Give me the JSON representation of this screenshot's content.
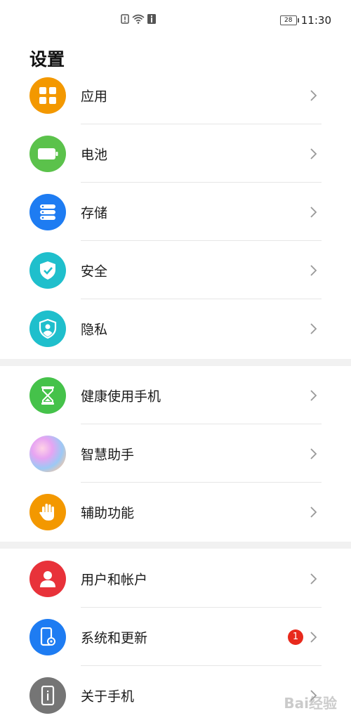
{
  "status": {
    "time": "11:30",
    "battery": "28"
  },
  "page": {
    "title": "设置"
  },
  "sections": [
    [
      {
        "label": "应用",
        "icon": "apps-icon",
        "color": "#f39800"
      },
      {
        "label": "电池",
        "icon": "battery-icon",
        "color": "#5bc24b"
      },
      {
        "label": "存储",
        "icon": "storage-icon",
        "color": "#1e7cf2"
      },
      {
        "label": "安全",
        "icon": "shield-check-icon",
        "color": "#1fbfcc"
      },
      {
        "label": "隐私",
        "icon": "privacy-icon",
        "color": "#1fbfcc"
      }
    ],
    [
      {
        "label": "健康使用手机",
        "icon": "hourglass-icon",
        "color": "#45c24a"
      },
      {
        "label": "智慧助手",
        "icon": "assistant-icon",
        "color": "gradient"
      },
      {
        "label": "辅助功能",
        "icon": "hand-icon",
        "color": "#f39800"
      }
    ],
    [
      {
        "label": "用户和帐户",
        "icon": "user-icon",
        "color": "#e8323a"
      },
      {
        "label": "系统和更新",
        "icon": "phone-settings-icon",
        "color": "#1e7cf2",
        "badge": "1"
      },
      {
        "label": "关于手机",
        "icon": "phone-info-icon",
        "color": "#757575"
      }
    ]
  ],
  "watermark": "Bai经验"
}
